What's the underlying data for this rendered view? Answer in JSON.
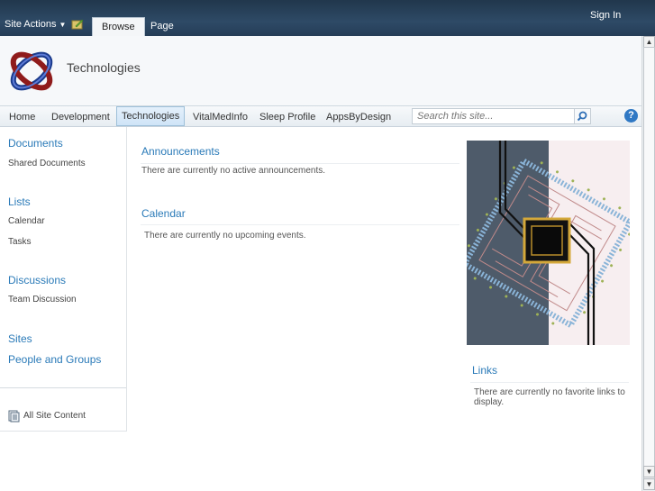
{
  "ribbon": {
    "site_actions": "Site Actions",
    "tabs": [
      "Browse",
      "Page"
    ],
    "sign_in": "Sign In"
  },
  "header": {
    "site_title": "Technologies"
  },
  "topnav": {
    "items": [
      "Home",
      "Development",
      "Technologies",
      "VitalMedInfo",
      "Sleep Profile",
      "AppsByDesign"
    ],
    "search_placeholder": "Search this site..."
  },
  "leftnav": {
    "documents": "Documents",
    "shared_documents": "Shared Documents",
    "lists": "Lists",
    "calendar": "Calendar",
    "tasks": "Tasks",
    "discussions": "Discussions",
    "team_discussion": "Team Discussion",
    "sites": "Sites",
    "people_and_groups": "People and Groups",
    "all_site_content": "All Site Content"
  },
  "main": {
    "announcements_title": "Announcements",
    "announcements_empty": "There are currently no active announcements.",
    "calendar_title": "Calendar",
    "calendar_empty": "There are currently no upcoming events."
  },
  "right": {
    "links_title": "Links",
    "links_empty": "There are currently no favorite links to display."
  },
  "colors": {
    "ribbon": "#21374c",
    "link_blue": "#2a7ab8",
    "accent": "#2f78c4"
  }
}
